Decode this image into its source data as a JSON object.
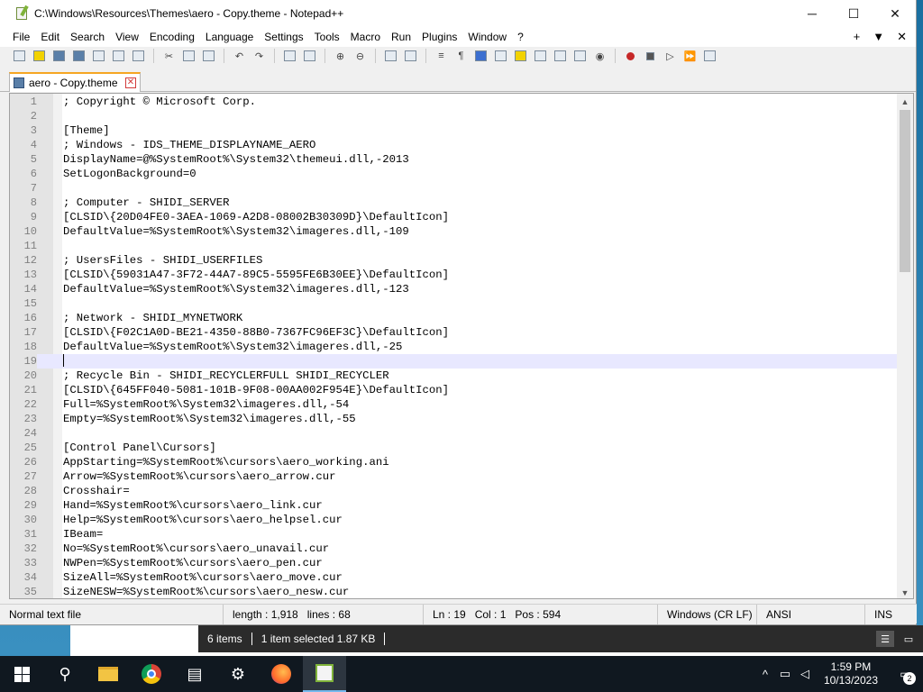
{
  "window": {
    "title": "C:\\Windows\\Resources\\Themes\\aero - Copy.theme - Notepad++",
    "minimize": "─",
    "maximize": "☐",
    "close": "✕"
  },
  "menu": {
    "items": [
      "File",
      "Edit",
      "Search",
      "View",
      "Encoding",
      "Language",
      "Settings",
      "Tools",
      "Macro",
      "Run",
      "Plugins",
      "Window",
      "?"
    ],
    "right": [
      "+",
      "▼",
      "✕"
    ]
  },
  "tab": {
    "label": "aero - Copy.theme",
    "close": "✕"
  },
  "editor": {
    "current_line": 19,
    "lines": [
      "; Copyright © Microsoft Corp.",
      "",
      "[Theme]",
      "; Windows - IDS_THEME_DISPLAYNAME_AERO",
      "DisplayName=@%SystemRoot%\\System32\\themeui.dll,-2013",
      "SetLogonBackground=0",
      "",
      "; Computer - SHIDI_SERVER",
      "[CLSID\\{20D04FE0-3AEA-1069-A2D8-08002B30309D}\\DefaultIcon]",
      "DefaultValue=%SystemRoot%\\System32\\imageres.dll,-109",
      "",
      "; UsersFiles - SHIDI_USERFILES",
      "[CLSID\\{59031A47-3F72-44A7-89C5-5595FE6B30EE}\\DefaultIcon]",
      "DefaultValue=%SystemRoot%\\System32\\imageres.dll,-123",
      "",
      "; Network - SHIDI_MYNETWORK",
      "[CLSID\\{F02C1A0D-BE21-4350-88B0-7367FC96EF3C}\\DefaultIcon]",
      "DefaultValue=%SystemRoot%\\System32\\imageres.dll,-25",
      "",
      "; Recycle Bin - SHIDI_RECYCLERFULL SHIDI_RECYCLER",
      "[CLSID\\{645FF040-5081-101B-9F08-00AA002F954E}\\DefaultIcon]",
      "Full=%SystemRoot%\\System32\\imageres.dll,-54",
      "Empty=%SystemRoot%\\System32\\imageres.dll,-55",
      "",
      "[Control Panel\\Cursors]",
      "AppStarting=%SystemRoot%\\cursors\\aero_working.ani",
      "Arrow=%SystemRoot%\\cursors\\aero_arrow.cur",
      "Crosshair=",
      "Hand=%SystemRoot%\\cursors\\aero_link.cur",
      "Help=%SystemRoot%\\cursors\\aero_helpsel.cur",
      "IBeam=",
      "No=%SystemRoot%\\cursors\\aero_unavail.cur",
      "NWPen=%SystemRoot%\\cursors\\aero_pen.cur",
      "SizeAll=%SystemRoot%\\cursors\\aero_move.cur",
      "SizeNESW=%SystemRoot%\\cursors\\aero_nesw.cur"
    ]
  },
  "status": {
    "file_type": "Normal text file",
    "length": "length : 1,918",
    "lines": "lines : 68",
    "ln": "Ln : 19",
    "col": "Col : 1",
    "pos": "Pos : 594",
    "eol": "Windows (CR LF)",
    "encoding": "ANSI",
    "mode": "INS"
  },
  "explorer": {
    "items": "6 items",
    "selected": "1 item selected  1.87 KB"
  },
  "taskbar": {
    "time": "1:59 PM",
    "date": "10/13/2023",
    "notifications": "2"
  }
}
